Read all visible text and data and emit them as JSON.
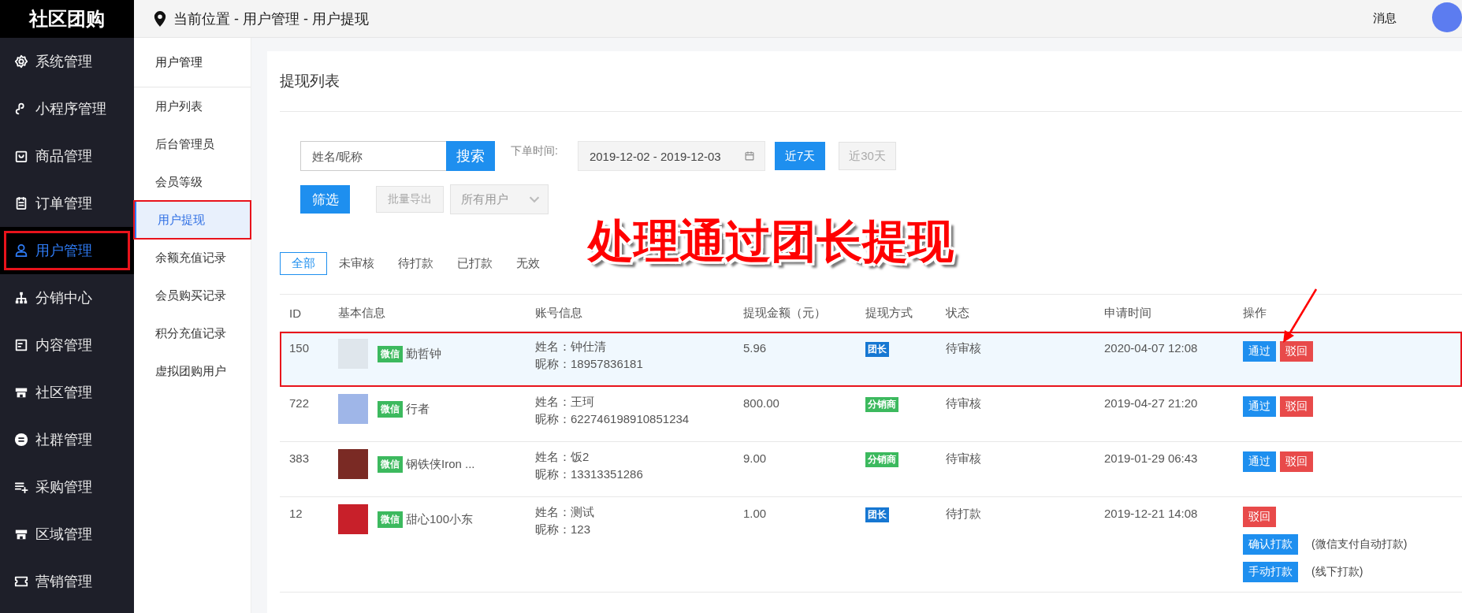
{
  "brand": "社区团购",
  "sidebar": {
    "items": [
      {
        "label": "系统管理",
        "selected": false,
        "framed": false
      },
      {
        "label": "小程序管理",
        "selected": false,
        "framed": false
      },
      {
        "label": "商品管理",
        "selected": false,
        "framed": false
      },
      {
        "label": "订单管理",
        "selected": false,
        "framed": false
      },
      {
        "label": "用户管理",
        "selected": true,
        "framed": true
      },
      {
        "label": "分销中心",
        "selected": false,
        "framed": false
      },
      {
        "label": "内容管理",
        "selected": false,
        "framed": false
      },
      {
        "label": "社区管理",
        "selected": false,
        "framed": false
      },
      {
        "label": "社群管理",
        "selected": false,
        "framed": false
      },
      {
        "label": "采购管理",
        "selected": false,
        "framed": false
      },
      {
        "label": "区域管理",
        "selected": false,
        "framed": false
      },
      {
        "label": "营销管理",
        "selected": false,
        "framed": false
      }
    ]
  },
  "breadcrumb": "当前位置 - 用户管理 - 用户提现",
  "header": {
    "messages": "消息"
  },
  "submenu": {
    "title": "用户管理",
    "items": [
      {
        "label": "用户列表",
        "selected": false,
        "framed": false
      },
      {
        "label": "后台管理员",
        "selected": false,
        "framed": false
      },
      {
        "label": "会员等级",
        "selected": false,
        "framed": false
      },
      {
        "label": "用户提现",
        "selected": true,
        "framed": true
      },
      {
        "label": "余额充值记录",
        "selected": false,
        "framed": false
      },
      {
        "label": "会员购买记录",
        "selected": false,
        "framed": false
      },
      {
        "label": "积分充值记录",
        "selected": false,
        "framed": false
      },
      {
        "label": "虚拟团购用户",
        "selected": false,
        "framed": false
      }
    ]
  },
  "panel": {
    "title": "提现列表",
    "search": {
      "placeholder": "姓名/昵称",
      "button": "搜索"
    },
    "date_filter": {
      "label": "下单时间:",
      "start": "2019-12-02",
      "separator": "-",
      "end": "2019-12-03"
    },
    "quick_ranges": [
      {
        "label": "近7天",
        "selected": true
      },
      {
        "label": "近30天",
        "selected": false
      }
    ],
    "filter_button": "筛选",
    "export_button": {
      "label": "批量导出",
      "disabled": true
    },
    "user_select": {
      "value": "所有用户"
    },
    "status_tabs": [
      {
        "label": "全部",
        "selected": true
      },
      {
        "label": "未审核",
        "selected": false
      },
      {
        "label": "待打款",
        "selected": false
      },
      {
        "label": "已打款",
        "selected": false
      },
      {
        "label": "无效",
        "selected": false
      }
    ],
    "table": {
      "columns": [
        "ID",
        "基本信息",
        "账号信息",
        "提现金额（元）",
        "提现方式",
        "状态",
        "申请时间",
        "操作"
      ],
      "rows": [
        {
          "id": "150",
          "channel": "微信",
          "nickname": "勤哲钟",
          "name": "姓名：钟仕清",
          "alias": "昵称：18957836181",
          "amount": "5.96",
          "method": {
            "label": "团长",
            "color": "#1677d2"
          },
          "status": "待审核",
          "time": "2020-04-07 12:08",
          "highlighted": true,
          "framed": true,
          "actions": [
            {
              "kind": "approve",
              "label": "通过"
            },
            {
              "kind": "reject",
              "label": "驳回"
            }
          ]
        },
        {
          "id": "722",
          "channel": "微信",
          "nickname": "行者",
          "name": "姓名：王珂",
          "alias": "昵称：622746198910851234",
          "amount": "800.00",
          "method": {
            "label": "分销商",
            "color": "#3cb95e"
          },
          "status": "待审核",
          "time": "2019-04-27 21:20",
          "highlighted": false,
          "framed": false,
          "actions": [
            {
              "kind": "approve",
              "label": "通过"
            },
            {
              "kind": "reject",
              "label": "驳回"
            }
          ]
        },
        {
          "id": "383",
          "channel": "微信",
          "nickname": "钢铁侠Iron ...",
          "name": "姓名：饭2",
          "alias": "昵称：13313351286",
          "amount": "9.00",
          "method": {
            "label": "分销商",
            "color": "#3cb95e"
          },
          "status": "待审核",
          "time": "2019-01-29 06:43",
          "highlighted": false,
          "framed": false,
          "actions": [
            {
              "kind": "approve",
              "label": "通过"
            },
            {
              "kind": "reject",
              "label": "驳回"
            }
          ]
        },
        {
          "id": "12",
          "channel": "微信",
          "nickname": "甜心100小东",
          "name": "姓名：测试",
          "alias": "昵称：123",
          "amount": "1.00",
          "method": {
            "label": "团长",
            "color": "#1677d2"
          },
          "status": "待打款",
          "time": "2019-12-21 14:08",
          "highlighted": false,
          "framed": false,
          "actions": [
            {
              "kind": "reject",
              "label": "驳回"
            },
            {
              "kind": "confirm",
              "label": "确认打款",
              "note": "(微信支付自动打款)"
            },
            {
              "kind": "manual",
              "label": "手动打款",
              "note": "(线下打款)"
            }
          ]
        }
      ]
    }
  },
  "annotation": {
    "text": "处理通过团长提现"
  }
}
